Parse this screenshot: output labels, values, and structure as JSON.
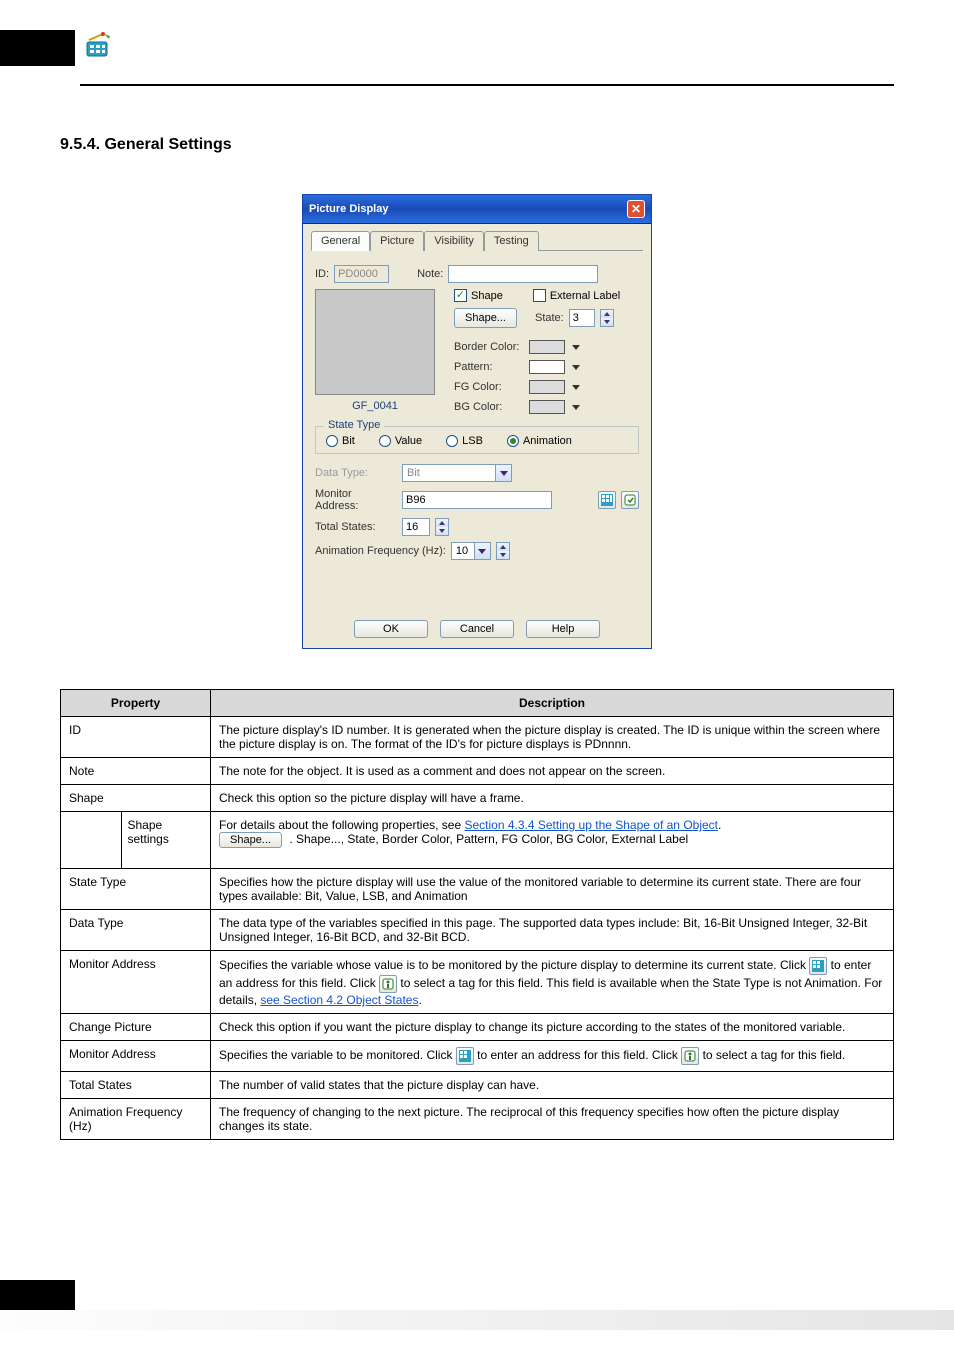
{
  "section_heading": "9.5.4. General Settings",
  "dialog": {
    "title": "Picture Display",
    "tabs": [
      "General",
      "Picture",
      "Visibility",
      "Testing"
    ],
    "active_tab": 0,
    "id_label": "ID:",
    "id_value": "PD0000",
    "note_label": "Note:",
    "note_value": "",
    "preview_caption": "GF_0041",
    "shape_cb": "Shape",
    "shape_checked": true,
    "ext_label_cb": "External Label",
    "ext_label_checked": false,
    "shape_btn": "Shape...",
    "state_label": "State:",
    "state_value": "3",
    "border_color_label": "Border Color:",
    "pattern_label": "Pattern:",
    "fg_color_label": "FG Color:",
    "bg_color_label": "BG Color:",
    "group_legend": "State Type",
    "radios": {
      "bit": "Bit",
      "value": "Value",
      "lsb": "LSB",
      "animation": "Animation"
    },
    "selected_radio": "animation",
    "data_type_label": "Data Type:",
    "data_type_value": "Bit",
    "monitor_label": "Monitor Address:",
    "monitor_value": "B96",
    "total_states_label": "Total States:",
    "total_states_value": "16",
    "anim_freq_label": "Animation Frequency (Hz):",
    "anim_freq_value": "10",
    "ok": "OK",
    "cancel": "Cancel",
    "help": "Help"
  },
  "table": {
    "headers": {
      "prop": "Property",
      "desc": "Description"
    },
    "rows": [
      {
        "prop": "ID",
        "desc": "The picture display's ID number. It is generated when the picture display is created. The ID is unique within the screen where the picture display is on. The format of the ID's for picture displays is PDnnnn."
      },
      {
        "prop": "Note",
        "desc": "The note for the object. It is used as a comment and does not appear on the screen."
      },
      {
        "prop": "Shape",
        "desc": "Check this option so the picture display will have a frame."
      },
      {
        "prop_l": "",
        "prop_r": "Shape settings",
        "desc_pre": "For details about the following properties, see ",
        "link": "Section 4.3.4 Setting up the Shape of an Object",
        "desc_post": ". Shape..., State, Border Color, Pattern, FG Color, BG Color, External Label"
      },
      {
        "prop": "State Type",
        "desc": "Specifies how the picture display will use the value of the monitored variable to determine its current state. There are four types available: Bit, Value, LSB, and Animation"
      },
      {
        "prop": "Data Type",
        "desc": "The data type of the variables specified in this page. The supported data types include: Bit, 16-Bit Unsigned Integer, 32-Bit Unsigned Integer, 16-Bit BCD, and 32-Bit BCD."
      },
      {
        "prop": "Monitor Address",
        "desc_pre": "Specifies the variable whose value is to be monitored by the picture display to determine its current state. Click ",
        "icon": "keypad",
        "desc_mid": " to enter an address for this field. Click ",
        "icon2": "tag",
        "desc_post": " to select a tag for this field. This field is available when the State Type is not Animation. For details, ",
        "link": "see Section 4.2 Object States",
        "link2_post": "."
      },
      {
        "prop": "Change Picture",
        "desc": "Check this option if you want the picture display to change its picture according to the states of the monitored variable."
      },
      {
        "prop": "Monitor Address",
        "desc_pre": "Specifies the variable to be monitored. Click ",
        "icon": "keypad",
        "desc_mid": " to enter an address for this field. Click ",
        "icon2": "tag",
        "desc_post": " to select a tag for this field."
      },
      {
        "prop": "Total States",
        "desc": "The number of valid states that the picture display can have."
      },
      {
        "prop": "Animation Frequency (Hz)",
        "desc": "The frequency of changing to the next picture. The reciprocal of this frequency specifies how often the picture display changes its state."
      }
    ]
  }
}
